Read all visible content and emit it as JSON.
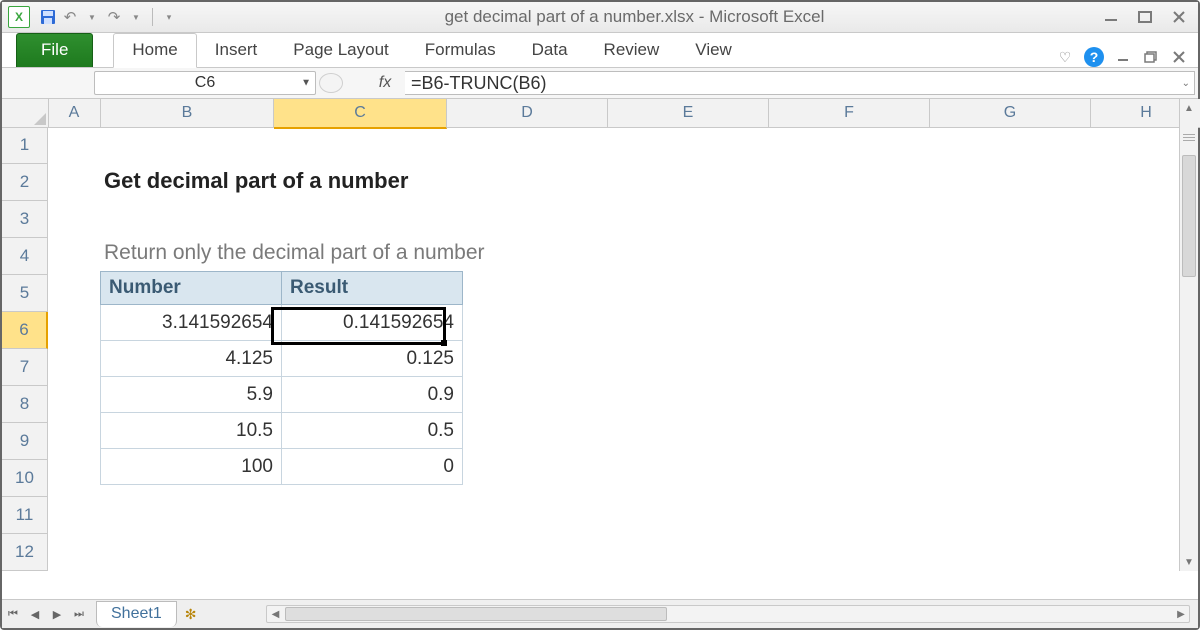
{
  "window": {
    "title": "get decimal part of a number.xlsx  -  Microsoft Excel"
  },
  "ribbon": {
    "file": "File",
    "tabs": [
      "Home",
      "Insert",
      "Page Layout",
      "Formulas",
      "Data",
      "Review",
      "View"
    ]
  },
  "nameBox": "C6",
  "formula": "=B6-TRUNC(B6)",
  "columns": [
    "A",
    "B",
    "C",
    "D",
    "E",
    "F",
    "G",
    "H"
  ],
  "rows": [
    "1",
    "2",
    "3",
    "4",
    "5",
    "6",
    "7",
    "8",
    "9",
    "10",
    "11",
    "12"
  ],
  "selected": {
    "col": "C",
    "row": "6"
  },
  "sheet": {
    "title": "Get decimal part of a number",
    "subtitle": "Return only the decimal part of a number",
    "hdr1": "Number",
    "hdr2": "Result",
    "data": [
      {
        "n": "3.141592654",
        "r": "0.141592654"
      },
      {
        "n": "4.125",
        "r": "0.125"
      },
      {
        "n": "5.9",
        "r": "0.9"
      },
      {
        "n": "10.5",
        "r": "0.5"
      },
      {
        "n": "100",
        "r": "0"
      }
    ]
  },
  "tabs": {
    "sheet1": "Sheet1"
  },
  "fx": "fx"
}
